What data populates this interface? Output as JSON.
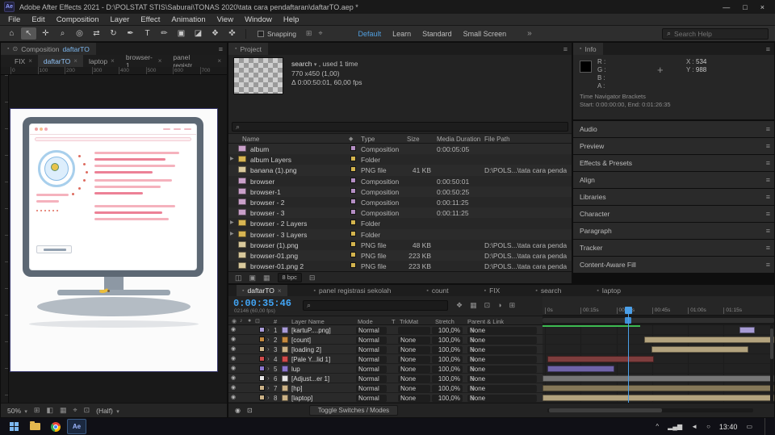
{
  "titlebar": {
    "app_badge": "Ae",
    "title": "Adobe After Effects 2021 - D:\\POLSTAT STIS\\Saburai\\TONAS 2020\\tata cara pendaftaran\\daftarTO.aep *",
    "minimize": "—",
    "maximize": "□",
    "close": "×"
  },
  "menubar": {
    "items": [
      "File",
      "Edit",
      "Composition",
      "Layer",
      "Effect",
      "Animation",
      "View",
      "Window",
      "Help"
    ]
  },
  "toolbar": {
    "tools": [
      {
        "glyph": "⌂",
        "name": "home-tool-icon"
      },
      {
        "glyph": "↖",
        "name": "selection-tool-icon",
        "bg": "#565656"
      },
      {
        "glyph": "✛",
        "name": "hand-tool-icon"
      },
      {
        "glyph": "⌕",
        "name": "zoom-tool-icon"
      },
      {
        "glyph": "◎",
        "name": "orbit-camera-tool-icon"
      },
      {
        "glyph": "⇄",
        "name": "pan-camera-tool-icon"
      },
      {
        "glyph": "↻",
        "name": "rotation-tool-icon"
      },
      {
        "glyph": "✒",
        "name": "pen-tool-icon"
      },
      {
        "glyph": "T",
        "name": "type-tool-icon"
      },
      {
        "glyph": "✏",
        "name": "brush-tool-icon"
      },
      {
        "glyph": "▣",
        "name": "clone-stamp-tool-icon"
      },
      {
        "glyph": "◪",
        "name": "eraser-tool-icon"
      },
      {
        "glyph": "❖",
        "name": "roto-brush-tool-icon"
      },
      {
        "glyph": "✜",
        "name": "puppet-pin-tool-icon"
      }
    ],
    "snapping_label": "Snapping",
    "post_icons": [
      {
        "glyph": "⊞",
        "name": "grid-options-icon"
      },
      {
        "glyph": "⌖",
        "name": "align-options-icon"
      }
    ],
    "workspaces": [
      {
        "label": "Default",
        "color": "#52a0e0"
      },
      {
        "label": "Learn"
      },
      {
        "label": "Standard"
      },
      {
        "label": "Small Screen"
      }
    ],
    "workspace_overflow": "»",
    "search_placeholder": "Search Help"
  },
  "comp_panel": {
    "grip": "▪",
    "lock_icon": "⊙",
    "panel_label": "Composition",
    "comp_name": "daftarTO",
    "hamburger": "≡",
    "tabs": [
      {
        "label": "FIX",
        "close": "×"
      },
      {
        "label": "daftarTO",
        "close": "×",
        "color": "#8fc1f5",
        "bg": "#2f2f2f"
      },
      {
        "label": "laptop",
        "close": "×"
      },
      {
        "label": "browser-1",
        "close": "×"
      },
      {
        "label": "panel registr...",
        "close": "×"
      }
    ],
    "ruler_numbers": [
      "0",
      "100",
      "200",
      "300",
      "400",
      "500",
      "600",
      "700"
    ],
    "bottom_bar": {
      "zoom": "50%",
      "caret": "▾",
      "resolution": "(Half)",
      "icons": [
        {
          "glyph": "⊞",
          "name": "choose-grid-icon"
        },
        {
          "glyph": "◧",
          "name": "region-of-interest-icon"
        },
        {
          "glyph": "▦",
          "name": "transparency-grid-icon"
        },
        {
          "glyph": "⌖",
          "name": "target-icon"
        },
        {
          "glyph": "⊡",
          "name": "camera-view-icon"
        }
      ]
    }
  },
  "project_panel": {
    "grip": "▪",
    "panel_label": "Project",
    "hamburger": "≡",
    "preview": {
      "comp_label": "search",
      "caret": "▾",
      "usage": ", used 1 time",
      "line2": "770 x450 (1,00)",
      "line3": "Δ 0:00:50:01, 60,00 fps"
    },
    "search_icon": "⌕",
    "columns": {
      "name": "Name",
      "swatch_icon": "◆",
      "type": "Type",
      "size": "Size",
      "duration": "Media Duration",
      "path": "File Path"
    },
    "rows": [
      {
        "name": "album",
        "type": "Composition",
        "duration": "0:00:05:05",
        "icon_color": "#c9a0c9",
        "swatch": "#b48ec4"
      },
      {
        "name": "album Layers",
        "type": "Folder",
        "arrow": "▶",
        "icon_color": "#d7b553",
        "swatch": "#d3b44e"
      },
      {
        "name": "banana (1).png",
        "type": "PNG file",
        "size": "41 KB",
        "path": "D:\\POLS...\\tata cara penda",
        "icon_color": "#d9c99c",
        "swatch": "#d3b44e"
      },
      {
        "name": "browser",
        "type": "Composition",
        "duration": "0:00:50:01",
        "icon_color": "#c9a0c9",
        "swatch": "#b48ec4"
      },
      {
        "name": "browser-1",
        "type": "Composition",
        "duration": "0:00:50:25",
        "icon_color": "#c9a0c9",
        "swatch": "#b48ec4"
      },
      {
        "name": "browser - 2",
        "type": "Composition",
        "duration": "0:00:11:25",
        "icon_color": "#c9a0c9",
        "swatch": "#b48ec4"
      },
      {
        "name": "browser - 3",
        "type": "Composition",
        "duration": "0:00:11:25",
        "icon_color": "#c9a0c9",
        "swatch": "#b48ec4"
      },
      {
        "name": "browser - 2 Layers",
        "type": "Folder",
        "arrow": "▶",
        "icon_color": "#d7b553",
        "swatch": "#d3b44e"
      },
      {
        "name": "browser - 3 Layers",
        "type": "Folder",
        "arrow": "▶",
        "icon_color": "#d7b553",
        "swatch": "#d3b44e"
      },
      {
        "name": "browser (1).png",
        "type": "PNG file",
        "size": "48 KB",
        "path": "D:\\POLS...\\tata cara penda",
        "icon_color": "#d9c99c",
        "swatch": "#d3b44e"
      },
      {
        "name": "browser-01.png",
        "type": "PNG file",
        "size": "223 KB",
        "path": "D:\\POLS...\\tata cara penda",
        "icon_color": "#d9c99c",
        "swatch": "#d3b44e"
      },
      {
        "name": "browser-01.png 2",
        "type": "PNG file",
        "size": "223 KB",
        "path": "D:\\POLS...\\tata cara penda",
        "icon_color": "#d9c99c",
        "swatch": "#d3b44e"
      }
    ],
    "footer": {
      "icons": [
        {
          "glyph": "◫",
          "name": "interpret-footage-icon"
        },
        {
          "glyph": "▣",
          "name": "new-folder-icon"
        },
        {
          "glyph": "▦",
          "name": "new-composition-icon"
        }
      ],
      "bit_depth": "8 bpc",
      "delete_icon": "⊟"
    }
  },
  "info_panel": {
    "panel_label": "Info",
    "grip": "▪",
    "hamburger": "≡",
    "r_label": "R :",
    "g_label": "G :",
    "b_label": "B :",
    "a_label": "A :",
    "crosshair": "+",
    "x_label": "X :",
    "x_value": "534",
    "y_label": "Y :",
    "y_value": "988",
    "nav_title": "Time Navigator Brackets",
    "nav_range": "Start: 0:00:00:00, End: 0:01:26:35",
    "sections": [
      "Audio",
      "Preview",
      "Effects & Presets",
      "Align",
      "Libraries",
      "Character",
      "Paragraph",
      "Tracker",
      "Content-Aware Fill"
    ]
  },
  "timeline": {
    "tabs": [
      {
        "grip": "▪",
        "label": "daftarTO",
        "close": "×",
        "color": "#e3e3e3",
        "bg": "#2f2f2f"
      },
      {
        "grip": "▪",
        "label": "panel registrasi sekolah"
      },
      {
        "grip": "▪",
        "label": "count"
      },
      {
        "grip": "▪",
        "label": "FIX"
      },
      {
        "grip": "▪",
        "label": "search"
      },
      {
        "grip": "▪",
        "label": "laptop"
      }
    ],
    "timecode": "0:00:35:46",
    "frame_info": "02146 (60,00 fps)",
    "search_icon": "⌕",
    "toolbar_icons": [
      {
        "glyph": "❖",
        "name": "mini-flowchart-icon"
      },
      {
        "glyph": "▦",
        "name": "draft-3d-icon"
      },
      {
        "glyph": "⊡",
        "name": "frame-blending-icon"
      },
      {
        "glyph": "◑",
        "name": "motion-blur-icon"
      },
      {
        "glyph": "⊞",
        "name": "graph-editor-icon"
      }
    ],
    "header_icons": [
      {
        "glyph": "◉",
        "name": "video-column-icon"
      },
      {
        "glyph": "♪",
        "name": "audio-column-icon"
      },
      {
        "glyph": "●",
        "name": "solo-column-icon"
      },
      {
        "glyph": "⊡",
        "name": "lock-column-icon"
      }
    ],
    "columns": {
      "number": "#",
      "layer_name": "Layer Name",
      "mode": "Mode",
      "t": "T",
      "trkmat": "TrkMat",
      "stretch": "Stretch",
      "parent": "Parent & Link"
    },
    "mode_caret": "▾",
    "pickwhip": "◎",
    "ruler_labels": [
      {
        "text": "0s",
        "left": "1%"
      },
      {
        "text": "00:15s",
        "left": "16.4%"
      },
      {
        "text": "00:30s",
        "left": "31.9%"
      },
      {
        "text": "00:45s",
        "left": "47.3%"
      },
      {
        "text": "01:00s",
        "left": "62.8%"
      },
      {
        "text": "01:15s",
        "left": "78.2%"
      }
    ],
    "playhead_left": "37%",
    "cache_width": "42%",
    "layers": [
      {
        "eye": "◉",
        "expander": "›",
        "num": "1",
        "name": "[kartuP....png]",
        "mode": "Normal",
        "stretch": "100,0%",
        "parent": "None",
        "color": "#a99bd8",
        "bar_left": "85%",
        "bar_width": "6.5%",
        "bar_color": "#a79bd4"
      },
      {
        "eye": "◉",
        "expander": "›",
        "num": "2",
        "name": "[count]",
        "mode": "Normal",
        "trkmat": "None",
        "trkmat_caret": "▾",
        "stretch": "100,0%",
        "parent": "None",
        "color": "#c58a3f",
        "bar_left": "44%",
        "bar_width": "56%",
        "bar_color": "#b3a37e"
      },
      {
        "eye": "◉",
        "expander": "›",
        "num": "3",
        "name": "[loading 2]",
        "mode": "Normal",
        "trkmat": "None",
        "trkmat_caret": "▾",
        "stretch": "100,0%",
        "parent": "None",
        "color": "#cbb287",
        "bar_left": "47%",
        "bar_width": "42%",
        "bar_color": "#b3a37e"
      },
      {
        "eye": "◉",
        "expander": "›",
        "num": "4",
        "name": "[Pale Y...lid 1]",
        "mode": "Normal",
        "trkmat": "None",
        "trkmat_caret": "▾",
        "stretch": "100,0%",
        "parent": "None",
        "color": "#d04b4b",
        "bar_left": "2%",
        "bar_width": "46%",
        "bar_color": "#7e3d3d"
      },
      {
        "eye": "◉",
        "expander": "›",
        "num": "5",
        "name": "lup",
        "mode": "Normal",
        "trkmat": "None",
        "trkmat_caret": "▾",
        "stretch": "100,0%",
        "parent": "None",
        "color": "#8a76cc",
        "bar_left": "2%",
        "bar_width": "29%",
        "bar_color": "#6f63a8"
      },
      {
        "eye": "◉",
        "expander": "›",
        "num": "6",
        "name": "[Adjust...er 1]",
        "mode": "Normal",
        "trkmat": "None",
        "trkmat_caret": "▾",
        "stretch": "100,0%",
        "parent": "None",
        "color": "#e6e6e6",
        "bar_left": "0%",
        "bar_width": "100%",
        "bar_color": "#767676"
      },
      {
        "eye": "◉",
        "expander": "›",
        "num": "7",
        "name": "[hp]",
        "mode": "Normal",
        "trkmat": "None",
        "trkmat_caret": "▾",
        "stretch": "100,0%",
        "parent": "None",
        "color": "#cbb287",
        "bar_left": "0%",
        "bar_width": "100%",
        "bar_color": "#847758"
      },
      {
        "eye": "◉",
        "expander": "›",
        "num": "8",
        "name": "[laptop]",
        "mode": "Normal",
        "trkmat": "None",
        "trkmat_caret": "▾",
        "stretch": "100,0%",
        "parent": "None",
        "color": "#cbb287",
        "bar_left": "0%",
        "bar_width": "100%",
        "bar_color": "#b3a37e"
      }
    ],
    "footer_icons": [
      {
        "glyph": "◉",
        "name": "composition-marker-icon"
      },
      {
        "glyph": "⊡",
        "name": "timeline-options-icon"
      }
    ],
    "toggle_label": "Toggle Switches / Modes"
  },
  "colors": {
    "timecode_blue": "#42a5f5",
    "cache_green": "#3dbb52",
    "playhead_blue": "#4b9fe8"
  },
  "taskbar": {
    "tray_icons": [
      {
        "glyph": "^",
        "name": "tray-expand-icon"
      },
      {
        "glyph": "▂▄▆",
        "name": "network-signal-icon"
      },
      {
        "glyph": "◄",
        "name": "volume-icon"
      },
      {
        "glyph": "○",
        "name": "globe-icon"
      }
    ],
    "time": "13:40",
    "notification_icon": "▭",
    "ae_label": "Ae"
  }
}
